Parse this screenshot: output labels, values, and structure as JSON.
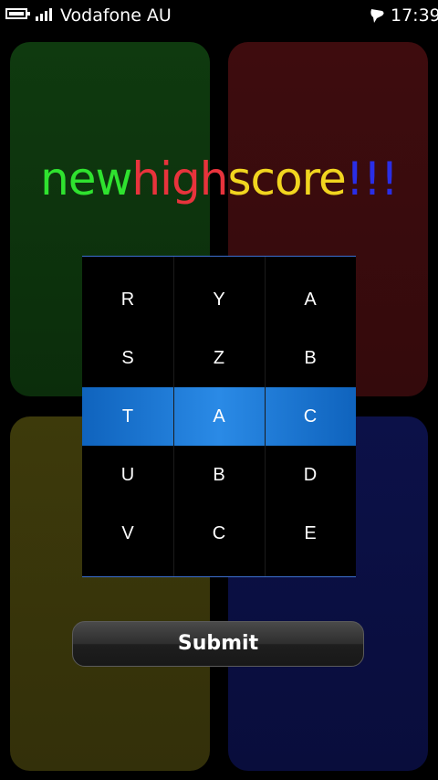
{
  "status_bar": {
    "carrier": "Vodafone AU",
    "time": "17:39",
    "icons": [
      "battery-icon",
      "signal-icon",
      "message-icon"
    ]
  },
  "panel_colors": {
    "green": "#0f3a0f",
    "red": "#3e0c0e",
    "yellow": "#3d3a0b",
    "blue": "#0c1148"
  },
  "title": {
    "part1": "new",
    "part2": "high",
    "part3": "score",
    "part4": "!!!",
    "colors": [
      "#2fe22f",
      "#e8333c",
      "#f1d51f",
      "#2a2ee6"
    ]
  },
  "picker": {
    "highlight_color": "#1d7fd9",
    "selected_row": 2,
    "columns": [
      [
        "R",
        "S",
        "T",
        "U",
        "V"
      ],
      [
        "Y",
        "Z",
        "A",
        "B",
        "C"
      ],
      [
        "A",
        "B",
        "C",
        "D",
        "E"
      ]
    ]
  },
  "submit": {
    "label": "Submit"
  }
}
